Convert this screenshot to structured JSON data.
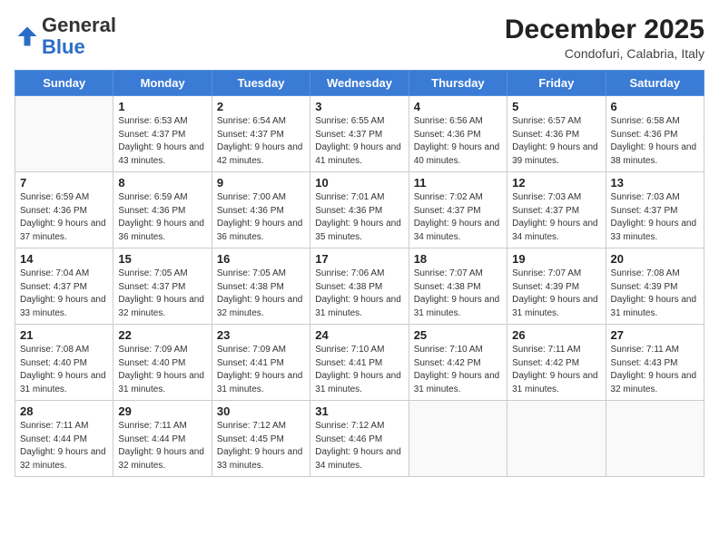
{
  "header": {
    "logo_general": "General",
    "logo_blue": "Blue",
    "month_year": "December 2025",
    "location": "Condofuri, Calabria, Italy"
  },
  "weekdays": [
    "Sunday",
    "Monday",
    "Tuesday",
    "Wednesday",
    "Thursday",
    "Friday",
    "Saturday"
  ],
  "weeks": [
    [
      {
        "day": "",
        "sunrise": "",
        "sunset": "",
        "daylight": ""
      },
      {
        "day": "1",
        "sunrise": "Sunrise: 6:53 AM",
        "sunset": "Sunset: 4:37 PM",
        "daylight": "Daylight: 9 hours and 43 minutes."
      },
      {
        "day": "2",
        "sunrise": "Sunrise: 6:54 AM",
        "sunset": "Sunset: 4:37 PM",
        "daylight": "Daylight: 9 hours and 42 minutes."
      },
      {
        "day": "3",
        "sunrise": "Sunrise: 6:55 AM",
        "sunset": "Sunset: 4:37 PM",
        "daylight": "Daylight: 9 hours and 41 minutes."
      },
      {
        "day": "4",
        "sunrise": "Sunrise: 6:56 AM",
        "sunset": "Sunset: 4:36 PM",
        "daylight": "Daylight: 9 hours and 40 minutes."
      },
      {
        "day": "5",
        "sunrise": "Sunrise: 6:57 AM",
        "sunset": "Sunset: 4:36 PM",
        "daylight": "Daylight: 9 hours and 39 minutes."
      },
      {
        "day": "6",
        "sunrise": "Sunrise: 6:58 AM",
        "sunset": "Sunset: 4:36 PM",
        "daylight": "Daylight: 9 hours and 38 minutes."
      }
    ],
    [
      {
        "day": "7",
        "sunrise": "Sunrise: 6:59 AM",
        "sunset": "Sunset: 4:36 PM",
        "daylight": "Daylight: 9 hours and 37 minutes."
      },
      {
        "day": "8",
        "sunrise": "Sunrise: 6:59 AM",
        "sunset": "Sunset: 4:36 PM",
        "daylight": "Daylight: 9 hours and 36 minutes."
      },
      {
        "day": "9",
        "sunrise": "Sunrise: 7:00 AM",
        "sunset": "Sunset: 4:36 PM",
        "daylight": "Daylight: 9 hours and 36 minutes."
      },
      {
        "day": "10",
        "sunrise": "Sunrise: 7:01 AM",
        "sunset": "Sunset: 4:36 PM",
        "daylight": "Daylight: 9 hours and 35 minutes."
      },
      {
        "day": "11",
        "sunrise": "Sunrise: 7:02 AM",
        "sunset": "Sunset: 4:37 PM",
        "daylight": "Daylight: 9 hours and 34 minutes."
      },
      {
        "day": "12",
        "sunrise": "Sunrise: 7:03 AM",
        "sunset": "Sunset: 4:37 PM",
        "daylight": "Daylight: 9 hours and 34 minutes."
      },
      {
        "day": "13",
        "sunrise": "Sunrise: 7:03 AM",
        "sunset": "Sunset: 4:37 PM",
        "daylight": "Daylight: 9 hours and 33 minutes."
      }
    ],
    [
      {
        "day": "14",
        "sunrise": "Sunrise: 7:04 AM",
        "sunset": "Sunset: 4:37 PM",
        "daylight": "Daylight: 9 hours and 33 minutes."
      },
      {
        "day": "15",
        "sunrise": "Sunrise: 7:05 AM",
        "sunset": "Sunset: 4:37 PM",
        "daylight": "Daylight: 9 hours and 32 minutes."
      },
      {
        "day": "16",
        "sunrise": "Sunrise: 7:05 AM",
        "sunset": "Sunset: 4:38 PM",
        "daylight": "Daylight: 9 hours and 32 minutes."
      },
      {
        "day": "17",
        "sunrise": "Sunrise: 7:06 AM",
        "sunset": "Sunset: 4:38 PM",
        "daylight": "Daylight: 9 hours and 31 minutes."
      },
      {
        "day": "18",
        "sunrise": "Sunrise: 7:07 AM",
        "sunset": "Sunset: 4:38 PM",
        "daylight": "Daylight: 9 hours and 31 minutes."
      },
      {
        "day": "19",
        "sunrise": "Sunrise: 7:07 AM",
        "sunset": "Sunset: 4:39 PM",
        "daylight": "Daylight: 9 hours and 31 minutes."
      },
      {
        "day": "20",
        "sunrise": "Sunrise: 7:08 AM",
        "sunset": "Sunset: 4:39 PM",
        "daylight": "Daylight: 9 hours and 31 minutes."
      }
    ],
    [
      {
        "day": "21",
        "sunrise": "Sunrise: 7:08 AM",
        "sunset": "Sunset: 4:40 PM",
        "daylight": "Daylight: 9 hours and 31 minutes."
      },
      {
        "day": "22",
        "sunrise": "Sunrise: 7:09 AM",
        "sunset": "Sunset: 4:40 PM",
        "daylight": "Daylight: 9 hours and 31 minutes."
      },
      {
        "day": "23",
        "sunrise": "Sunrise: 7:09 AM",
        "sunset": "Sunset: 4:41 PM",
        "daylight": "Daylight: 9 hours and 31 minutes."
      },
      {
        "day": "24",
        "sunrise": "Sunrise: 7:10 AM",
        "sunset": "Sunset: 4:41 PM",
        "daylight": "Daylight: 9 hours and 31 minutes."
      },
      {
        "day": "25",
        "sunrise": "Sunrise: 7:10 AM",
        "sunset": "Sunset: 4:42 PM",
        "daylight": "Daylight: 9 hours and 31 minutes."
      },
      {
        "day": "26",
        "sunrise": "Sunrise: 7:11 AM",
        "sunset": "Sunset: 4:42 PM",
        "daylight": "Daylight: 9 hours and 31 minutes."
      },
      {
        "day": "27",
        "sunrise": "Sunrise: 7:11 AM",
        "sunset": "Sunset: 4:43 PM",
        "daylight": "Daylight: 9 hours and 32 minutes."
      }
    ],
    [
      {
        "day": "28",
        "sunrise": "Sunrise: 7:11 AM",
        "sunset": "Sunset: 4:44 PM",
        "daylight": "Daylight: 9 hours and 32 minutes."
      },
      {
        "day": "29",
        "sunrise": "Sunrise: 7:11 AM",
        "sunset": "Sunset: 4:44 PM",
        "daylight": "Daylight: 9 hours and 32 minutes."
      },
      {
        "day": "30",
        "sunrise": "Sunrise: 7:12 AM",
        "sunset": "Sunset: 4:45 PM",
        "daylight": "Daylight: 9 hours and 33 minutes."
      },
      {
        "day": "31",
        "sunrise": "Sunrise: 7:12 AM",
        "sunset": "Sunset: 4:46 PM",
        "daylight": "Daylight: 9 hours and 34 minutes."
      },
      {
        "day": "",
        "sunrise": "",
        "sunset": "",
        "daylight": ""
      },
      {
        "day": "",
        "sunrise": "",
        "sunset": "",
        "daylight": ""
      },
      {
        "day": "",
        "sunrise": "",
        "sunset": "",
        "daylight": ""
      }
    ]
  ]
}
